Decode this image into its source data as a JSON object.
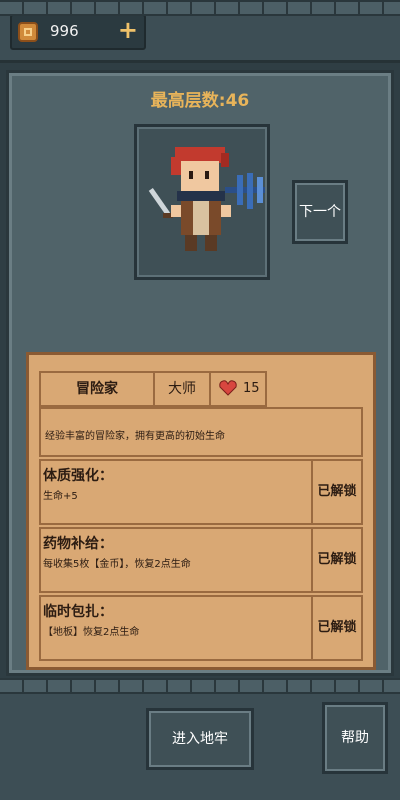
{
  "currency": {
    "amount": "996",
    "add_label": "+",
    "icon": "coin-icon"
  },
  "title": "最高层数:46",
  "character": {
    "icon": "pixel-adventurer-with-sword"
  },
  "next_button": "下一个",
  "card": {
    "name": "冒险家",
    "rank": "大师",
    "hp": "15",
    "description": "经验丰富的冒险家，拥有更高的初始生命",
    "perks": [
      {
        "title": "体质强化：",
        "detail": "生命+5",
        "status": "已解锁"
      },
      {
        "title": "药物补给：",
        "detail": "每收集5枚【金币】，恢复2点生命",
        "status": "已解锁"
      },
      {
        "title": "临时包扎：",
        "detail": "【地板】恢复2点生命",
        "status": "已解锁"
      }
    ]
  },
  "buttons": {
    "enter": "进入地牢",
    "help": "帮助"
  },
  "colors": {
    "title": "#e8b45a",
    "parchment": "#d9a874",
    "panel": "#506369"
  }
}
